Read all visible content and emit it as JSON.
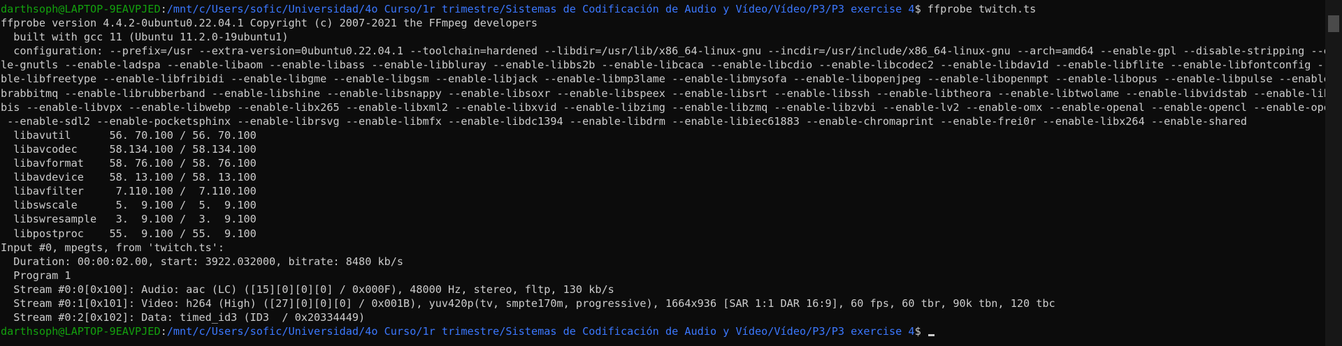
{
  "prompt": {
    "user_host": "darthsoph@LAPTOP-9EAVPJED",
    "separator": ":",
    "path": "/mnt/c/Users/sofic/Universidad/4o Curso/1r trimestre/Sistemas de Codificación de Audio y Vídeo/Vídeo/P3/P3 exercise 4",
    "symbol": "$ ",
    "command": "ffprobe twitch.ts"
  },
  "output": [
    "ffprobe version 4.4.2-0ubuntu0.22.04.1 Copyright (c) 2007-2021 the FFmpeg developers",
    "  built with gcc 11 (Ubuntu 11.2.0-19ubuntu1)",
    "  configuration: --prefix=/usr --extra-version=0ubuntu0.22.04.1 --toolchain=hardened --libdir=/usr/lib/x86_64-linux-gnu --incdir=/usr/include/x86_64-linux-gnu --arch=amd64 --enable-gpl --disable-stripping --enab",
    "le-gnutls --enable-ladspa --enable-libaom --enable-libass --enable-libbluray --enable-libbs2b --enable-libcaca --enable-libcdio --enable-libcodec2 --enable-libdav1d --enable-libflite --enable-libfontconfig --ena",
    "ble-libfreetype --enable-libfribidi --enable-libgme --enable-libgsm --enable-libjack --enable-libmp3lame --enable-libmysofa --enable-libopenjpeg --enable-libopenmpt --enable-libopus --enable-libpulse --enable-li",
    "brabbitmq --enable-librubberband --enable-libshine --enable-libsnappy --enable-libsoxr --enable-libspeex --enable-libsrt --enable-libssh --enable-libtheora --enable-libtwolame --enable-libvidstab --enable-libvor",
    "bis --enable-libvpx --enable-libwebp --enable-libx265 --enable-libxml2 --enable-libxvid --enable-libzimg --enable-libzmq --enable-libzvbi --enable-lv2 --enable-omx --enable-openal --enable-opencl --enable-opengl",
    " --enable-sdl2 --enable-pocketsphinx --enable-librsvg --enable-libmfx --enable-libdc1394 --enable-libdrm --enable-libiec61883 --enable-chromaprint --enable-frei0r --enable-libx264 --enable-shared",
    "  libavutil      56. 70.100 / 56. 70.100",
    "  libavcodec     58.134.100 / 58.134.100",
    "  libavformat    58. 76.100 / 58. 76.100",
    "  libavdevice    58. 13.100 / 58. 13.100",
    "  libavfilter     7.110.100 /  7.110.100",
    "  libswscale      5.  9.100 /  5.  9.100",
    "  libswresample   3.  9.100 /  3.  9.100",
    "  libpostproc    55.  9.100 / 55.  9.100",
    "Input #0, mpegts, from 'twitch.ts':",
    "  Duration: 00:00:02.00, start: 3922.032000, bitrate: 8480 kb/s",
    "  Program 1",
    "  Stream #0:0[0x100]: Audio: aac (LC) ([15][0][0][0] / 0x000F), 48000 Hz, stereo, fltp, 130 kb/s",
    "  Stream #0:1[0x101]: Video: h264 (High) ([27][0][0][0] / 0x001B), yuv420p(tv, smpte170m, progressive), 1664x936 [SAR 1:1 DAR 16:9], 60 fps, 60 tbr, 90k tbn, 120 tbc",
    "  Stream #0:2[0x102]: Data: timed_id3 (ID3  / 0x20334449)"
  ],
  "cursor": "cursor-block",
  "colors": {
    "background": "#0c0c0c",
    "text": "#cccccc",
    "user_host": "#13a10e",
    "path": "#3b78ff"
  }
}
